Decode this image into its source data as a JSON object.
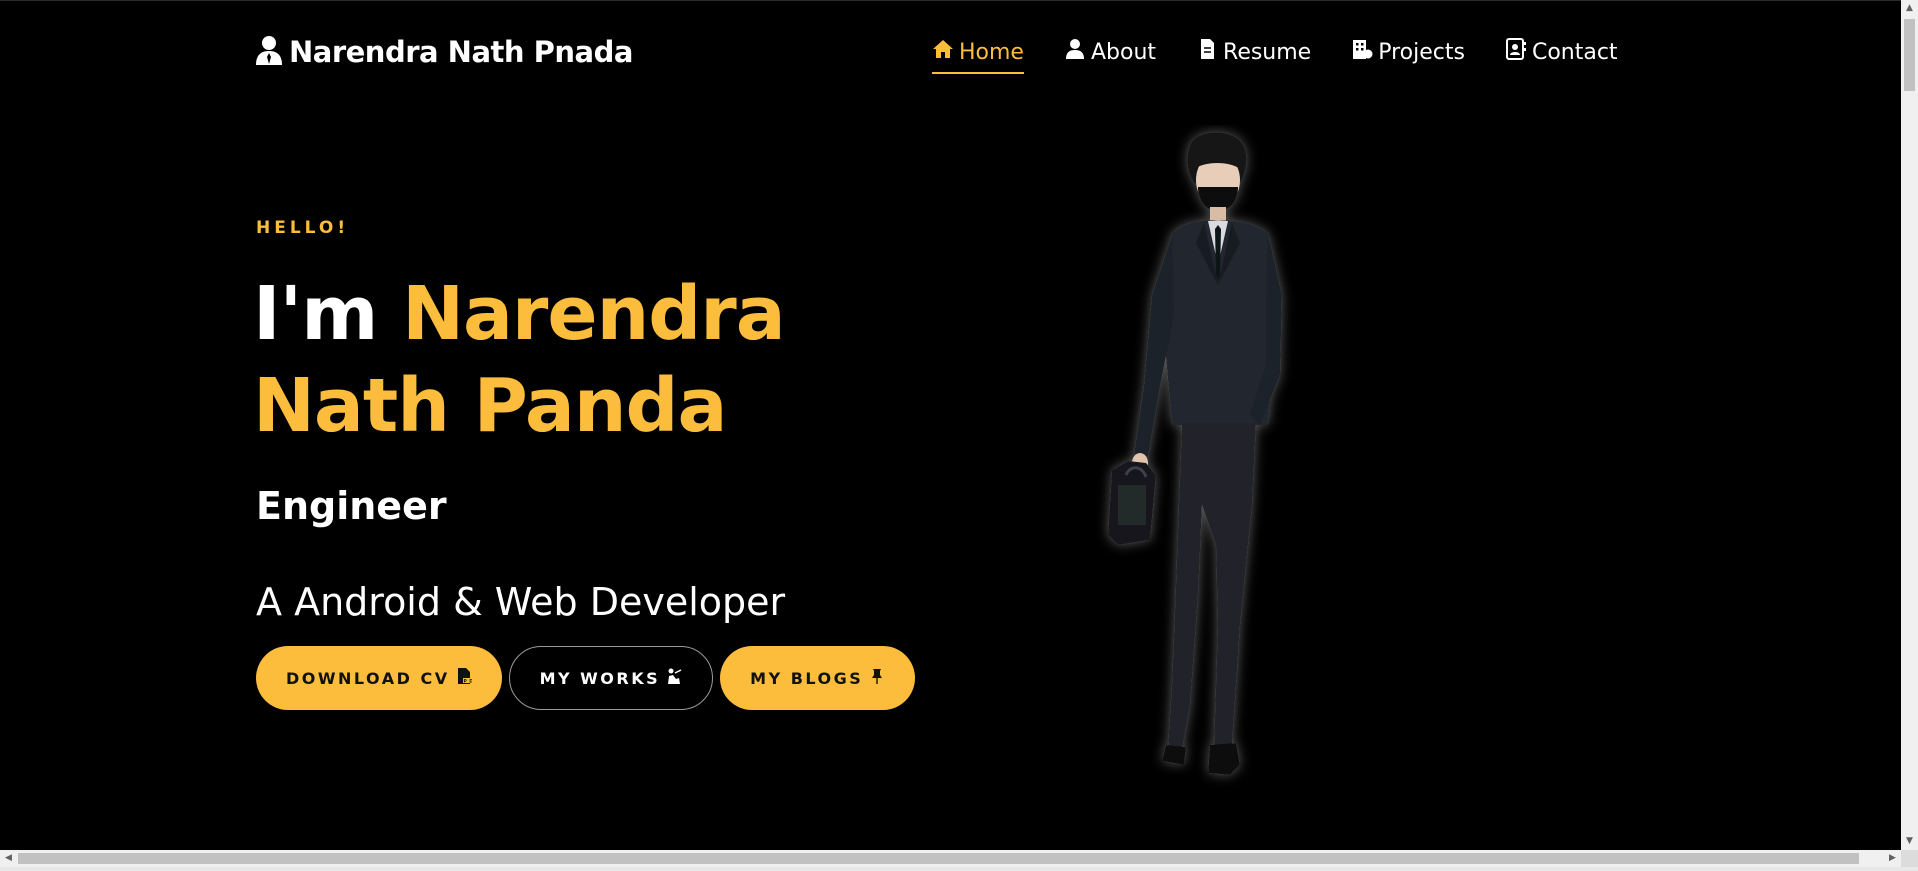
{
  "brand": {
    "name": "Narendra Nath Pnada",
    "icon": "user-icon"
  },
  "nav": {
    "items": [
      {
        "label": "Home",
        "icon": "home-icon",
        "active": true
      },
      {
        "label": "About",
        "icon": "user-icon",
        "active": false
      },
      {
        "label": "Resume",
        "icon": "file-icon",
        "active": false
      },
      {
        "label": "Projects",
        "icon": "building-icon",
        "active": false
      },
      {
        "label": "Contact",
        "icon": "contact-card-icon",
        "active": false
      }
    ]
  },
  "hero": {
    "greeting": "HELLO!",
    "headline_prefix": "I'm ",
    "name_line1": "Narendra",
    "name_line2": "Nath Panda",
    "role": "Engineer",
    "tagline": "A Android & Web Developer",
    "buttons": [
      {
        "label": "DOWNLOAD CV",
        "icon": "pdf-file-icon"
      },
      {
        "label": "MY WORKS",
        "icon": "worker-icon"
      },
      {
        "label": "MY BLOGS",
        "icon": "pin-icon"
      }
    ]
  },
  "colors": {
    "accent": "#fbbd3b",
    "background": "#000000",
    "text": "#ffffff"
  }
}
